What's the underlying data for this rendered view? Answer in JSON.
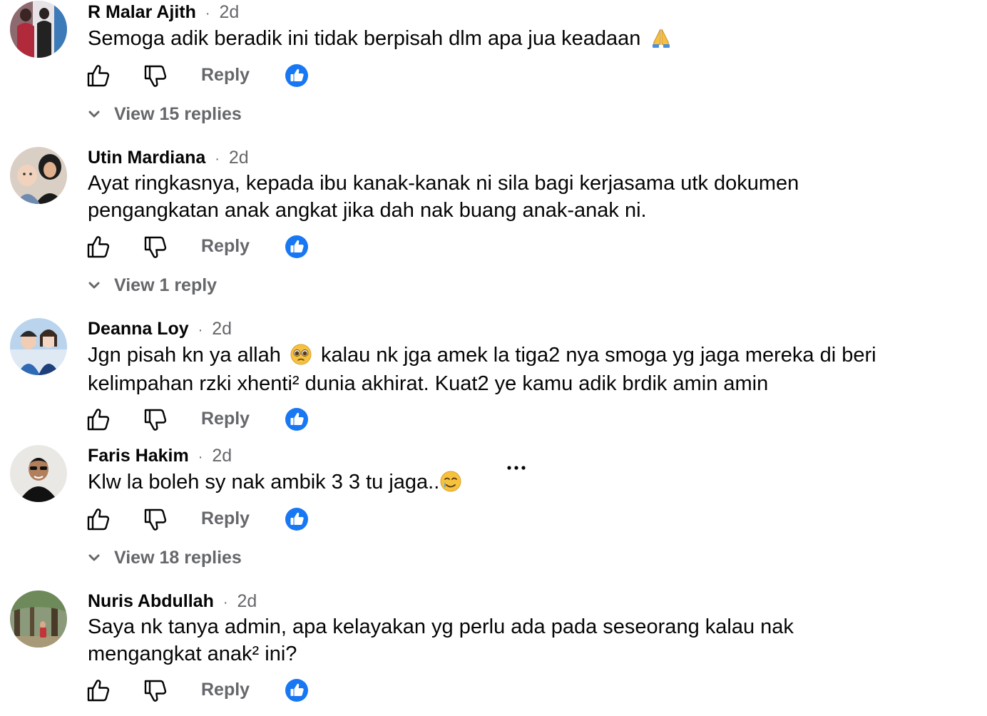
{
  "comments": [
    {
      "name": "R Malar Ajith",
      "time": "2d",
      "separator": "·",
      "text_before": "Semoga adik beradik ini tidak berpisah dlm apa jua keadaan",
      "emoji": "folded-hands",
      "text_after": "",
      "reply_label": "Reply",
      "view_replies": "View 15 replies"
    },
    {
      "name": "Utin Mardiana",
      "time": "2d",
      "separator": "·",
      "line1": "Ayat ringkasnya, kepada ibu kanak-kanak ni sila bagi kerjasama utk dokumen",
      "line2": "pengangkatan anak angkat jika dah nak buang anak-anak ni.",
      "reply_label": "Reply",
      "view_replies": "View 1 reply"
    },
    {
      "name": "Deanna Loy",
      "time": "2d",
      "separator": "·",
      "line1_before": "Jgn pisah kn ya allah",
      "emoji": "pleading-face",
      "line1_after": "kalau nk jga amek la tiga2 nya smoga yg jaga mereka di beri",
      "line2": "kelimpahan rzki xhenti² dunia akhirat. Kuat2 ye kamu adik brdik amin amin",
      "reply_label": "Reply"
    },
    {
      "name": "Faris Hakim",
      "time": "2d",
      "separator": "·",
      "text_before": "Klw la boleh sy nak ambik 3 3 tu jaga..",
      "emoji": "smiling-face-with-tear",
      "reply_label": "Reply",
      "view_replies": "View 18 replies"
    },
    {
      "name": "Nuris Abdullah",
      "time": "2d",
      "separator": "·",
      "line1": "Saya nk tanya admin, apa kelayakan yg perlu ada pada seseorang kalau nak",
      "line2": "mengangkat anak² ini?",
      "reply_label": "Reply"
    }
  ],
  "colors": {
    "text": "#050505",
    "secondary": "#65676b",
    "like_blue": "#1877f2"
  },
  "icons": [
    "like-icon",
    "dislike-icon",
    "like-reaction-icon",
    "chevron-down-icon",
    "more-options-icon"
  ]
}
